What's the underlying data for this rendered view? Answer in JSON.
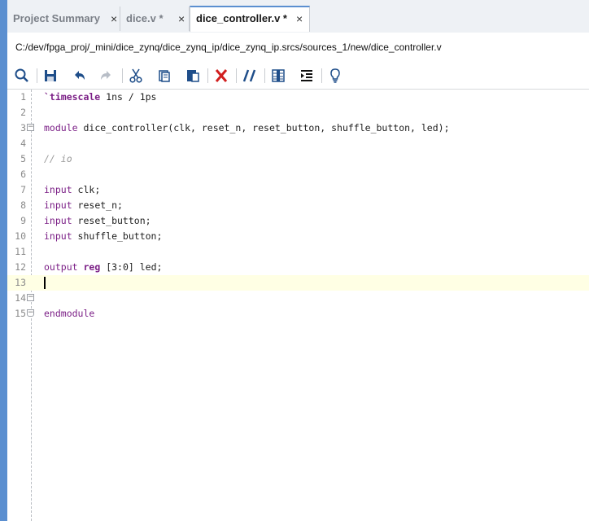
{
  "tabs": [
    {
      "label": "Project Summary",
      "close": "×"
    },
    {
      "label": "dice.v *",
      "close": "×"
    },
    {
      "label": "dice_controller.v *",
      "close": "×"
    }
  ],
  "path": "C:/dev/fpga_proj/_mini/dice_zynq/dice_zynq_ip/dice_zynq_ip.srcs/sources_1/new/dice_controller.v",
  "toolbar": [
    "search-icon",
    "save-icon",
    "undo-icon",
    "redo-icon",
    "cut-icon",
    "copy-icon",
    "paste-icon",
    "delete-icon",
    "comment-icon",
    "block-icon",
    "indent-icon",
    "lightbulb-icon"
  ],
  "code": {
    "lines": [
      {
        "n": "1",
        "t": ""
      },
      {
        "n": "2",
        "t": ""
      },
      {
        "n": "3",
        "t": ""
      },
      {
        "n": "4",
        "t": ""
      },
      {
        "n": "5",
        "t": ""
      },
      {
        "n": "6",
        "t": ""
      },
      {
        "n": "7",
        "t": ""
      },
      {
        "n": "8",
        "t": ""
      },
      {
        "n": "9",
        "t": ""
      },
      {
        "n": "10",
        "t": ""
      },
      {
        "n": "11",
        "t": ""
      },
      {
        "n": "12",
        "t": ""
      },
      {
        "n": "13",
        "t": ""
      },
      {
        "n": "14",
        "t": ""
      },
      {
        "n": "15",
        "t": ""
      }
    ],
    "l1_kw": "`timescale",
    "l1_rest": " 1ns / 1ps",
    "l3_kw": "module",
    "l3_rest": " dice_controller(clk, reset_n, reset_button, shuffle_button, led);",
    "l5_comment": "// io",
    "l7_kw": "input",
    "l7_rest": " clk;",
    "l8_kw": "input",
    "l8_rest": " reset_n;",
    "l9_kw": "input",
    "l9_rest": " reset_button;",
    "l10_kw": "input",
    "l10_rest": " shuffle_button;",
    "l12_kw": "output",
    "l12_kw2": "reg",
    "l12_rest": " [3:0] led;",
    "l15_kw": "endmodule"
  }
}
